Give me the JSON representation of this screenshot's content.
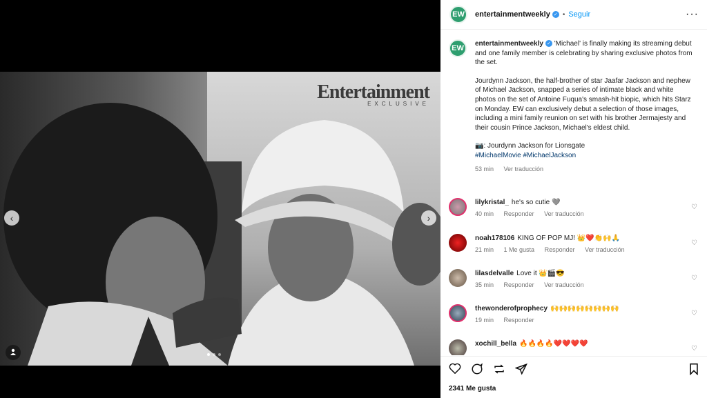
{
  "account": {
    "avatar_text": "EW",
    "username": "entertainmentweekly",
    "verified_glyph": "✓",
    "separator": "•",
    "follow_label": "Seguir",
    "more_glyph": "···"
  },
  "media": {
    "logo_word": "Entertainment",
    "logo_sub": "EXCLUSIVE",
    "prev_glyph": "‹",
    "next_glyph": "›",
    "user_tag_glyph": "👤"
  },
  "caption": {
    "username": "entertainmentweekly",
    "paragraph1": "'Michael' is finally making its streaming debut and one family member is celebrating by sharing exclusive photos from the set.",
    "paragraph2": "Jourdynn Jackson, the half-brother of star Jaafar Jackson and nephew of Michael Jackson, snapped a series of intimate black and white photos on the set of Antoine Fuqua's smash-hit biopic, which hits Starz on Monday. EW can exclusively debut a selection of those images, including a mini family reunion on set with his brother Jermajesty and their cousin Prince Jackson, Michael's eldest child.",
    "credit": "📷: Jourdynn Jackson for Lionsgate",
    "hashtags": "#MichaelMovie #MichaelJackson",
    "time": "53 min",
    "see_translation": "Ver traducción"
  },
  "comments": [
    {
      "username": "lilykristal_",
      "text": "he's so cutie 🩶",
      "time": "40 min",
      "likes": "",
      "reply": "Responder",
      "translate": "Ver traducción"
    },
    {
      "username": "noah178106",
      "text": "KING OF POP MJ! 👑❤️👏🙌🙏",
      "time": "21 min",
      "likes": "1 Me gusta",
      "reply": "Responder",
      "translate": "Ver traducción"
    },
    {
      "username": "lilasdelvalle",
      "text": "Love it 👑🎬😎",
      "time": "35 min",
      "likes": "",
      "reply": "Responder",
      "translate": "Ver traducción"
    },
    {
      "username": "thewonderofprophecy",
      "text": "🙌🙌🙌🙌🙌🙌🙌🙌",
      "time": "19 min",
      "likes": "",
      "reply": "Responder",
      "translate": ""
    },
    {
      "username": "xochill_bella",
      "text": "🔥🔥🔥🔥❤️❤️❤️❤️",
      "time": "",
      "likes": "",
      "reply": "",
      "translate": ""
    }
  ],
  "actions": {
    "like_glyph": "♡",
    "comment_glyph": "◯",
    "share_glyph": "⟲",
    "send_glyph": "➤",
    "save_glyph": "▯",
    "likes_count": "2341 Me gusta",
    "comment_heart": "♡"
  },
  "colors": {
    "accent": "#0095f6",
    "brand_green": "#2e9e6f",
    "verified": "#3897f0"
  }
}
